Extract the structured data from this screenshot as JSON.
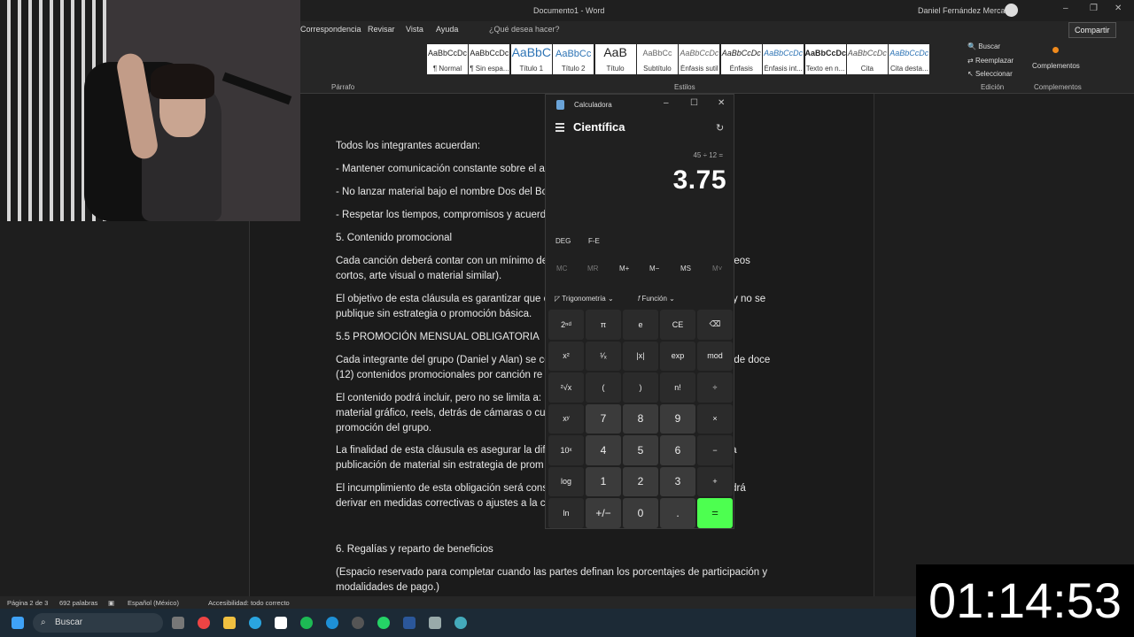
{
  "word": {
    "title": "Documento1  -  Word",
    "user": "Daniel Fernández Mercado",
    "share": "Compartir",
    "menus": [
      "Correspondencia",
      "Revisar",
      "Vista",
      "Ayuda"
    ],
    "tellme": "¿Qué desea hacer?",
    "styles": [
      {
        "preview": "AaBbCcDc",
        "name": "¶ Normal"
      },
      {
        "preview": "AaBbCcDc",
        "name": "¶ Sin espa..."
      },
      {
        "preview": "AaBbC",
        "name": "Título 1"
      },
      {
        "preview": "AaBbCc",
        "name": "Título 2"
      },
      {
        "preview": "AaB",
        "name": "Título"
      },
      {
        "preview": "AaBbCc",
        "name": "Subtítulo"
      },
      {
        "preview": "AaBbCcDc",
        "name": "Énfasis sutil"
      },
      {
        "preview": "AaBbCcDc",
        "name": "Énfasis"
      },
      {
        "preview": "AaBbCcDc",
        "name": "Énfasis int..."
      },
      {
        "preview": "AaBbCcDc",
        "name": "Texto en n..."
      },
      {
        "preview": "AaBbCcDc",
        "name": "Cita"
      },
      {
        "preview": "AaBbCcDc",
        "name": "Cita desta..."
      }
    ],
    "groups": {
      "paragraph": "Párrafo",
      "styles": "Estilos",
      "editing": "Edición",
      "addins": "Complementos"
    },
    "editing": {
      "find": "Buscar",
      "replace": "Reemplazar",
      "select": "Seleccionar"
    },
    "addins_label": "Complementos",
    "body": [
      "Todos los integrantes acuerdan:",
      "- Mantener comunicación constante sobre el a",
      "- No lanzar material bajo el nombre Dos del Bo",
      "- Respetar los tiempos, compromisos y acuerd",
      "5. Contenido promocional",
      "Cada canción deberá contar con un mínimo de                                                               ideos",
      "cortos, arte visual o material similar).",
      "El objetivo de esta cláusula es garantizar que c                                                              o y no se",
      "publique sin estrategia o promoción básica.",
      "5.5 PROMOCIÓN MENSUAL OBLIGATORIA",
      "Cada integrante del grupo (Daniel y Alan) se co                                                            no de doce",
      "(12) contenidos promocionales por canción re                                                                e.",
      "El contenido podrá incluir, pero no se limita a:                                                        ortos,",
      "material gráfico, reels, detrás de cámaras o cu                                                     a a la",
      "promoción del grupo.",
      "La finalidad de esta cláusula es asegurar la difu                                                    itando la",
      "publicación de material sin estrategia de prom",
      "El incumplimiento de esta obligación será cons                                                    ato y podrá",
      "derivar en medidas correctivas o ajustes a la c",
      "6. Regalías y reparto de beneficios",
      "(Espacio reservado para completar cuando las partes definan los porcentajes de participación y",
      "modalidades de pago.)"
    ],
    "status": {
      "page": "Página 2 de 3",
      "words": "692 palabras",
      "language": "Español (México)",
      "accessibility": "Accesibilidad: todo correcto"
    }
  },
  "calculator": {
    "title": "Calculadora",
    "mode": "Científica",
    "expression": "45 ÷ 12 =",
    "result": "3.75",
    "angle": "DEG",
    "fe": "F-E",
    "memory": [
      "MC",
      "MR",
      "M+",
      "M−",
      "MS",
      "M˅"
    ],
    "trig": "Trigonometría",
    "func": "Función",
    "keys": [
      "2ⁿᵈ",
      "π",
      "e",
      "CE",
      "⌫",
      "x²",
      "¹⁄ₓ",
      "|x|",
      "exp",
      "mod",
      "²√x",
      "(",
      ")",
      "n!",
      "÷",
      "xʸ",
      "7",
      "8",
      "9",
      "×",
      "10ˣ",
      "4",
      "5",
      "6",
      "−",
      "log",
      "1",
      "2",
      "3",
      "+",
      "ln",
      "+/−",
      "0",
      ".",
      "="
    ]
  },
  "taskbar": {
    "search": "Buscar"
  },
  "timer": "01:14:53",
  "colors": {
    "equals": "#4dff50",
    "taskbar": "#1c2a36"
  }
}
